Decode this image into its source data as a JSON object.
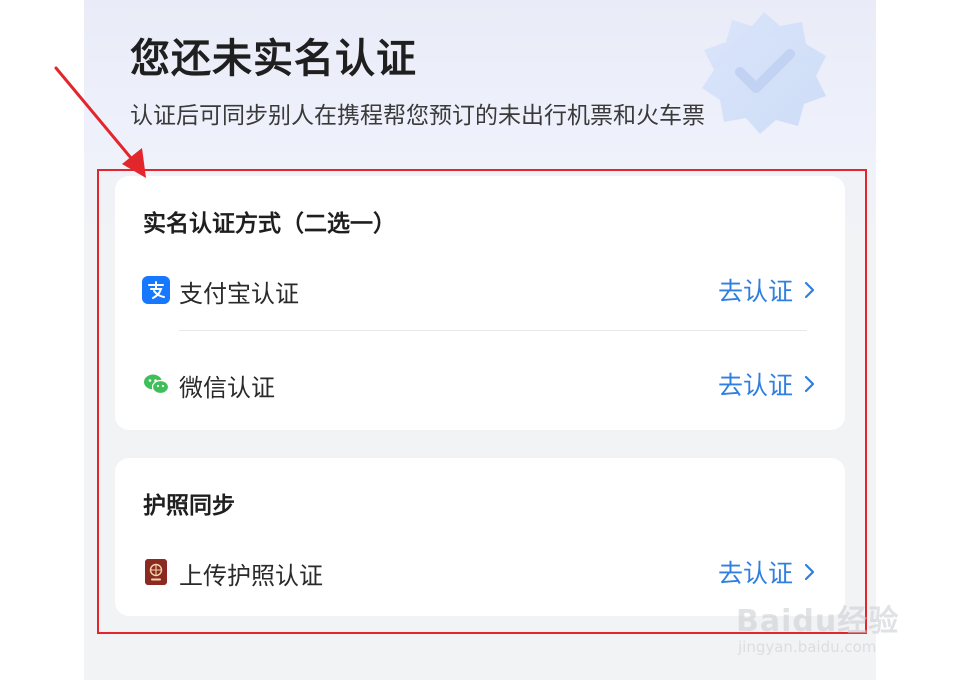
{
  "header": {
    "title": "您还未实名认证",
    "subtitle": "认证后可同步别人在携程帮您预订的未出行机票和火车票"
  },
  "realname_card": {
    "title": "实名认证方式（二选一）",
    "items": [
      {
        "label": "支付宝认证",
        "action": "去认证",
        "icon": "alipay-icon"
      },
      {
        "label": "微信认证",
        "action": "去认证",
        "icon": "wechat-icon"
      }
    ]
  },
  "passport_card": {
    "title": "护照同步",
    "items": [
      {
        "label": "上传护照认证",
        "action": "去认证",
        "icon": "passport-icon"
      }
    ]
  },
  "watermark": {
    "brand": "Baidu经验",
    "url": "jingyan.baidu.com"
  },
  "colors": {
    "accent": "#2f7fe0",
    "annotation": "#e3262b",
    "card_bg": "#ffffff",
    "page_bg": "#f2f3f5"
  }
}
